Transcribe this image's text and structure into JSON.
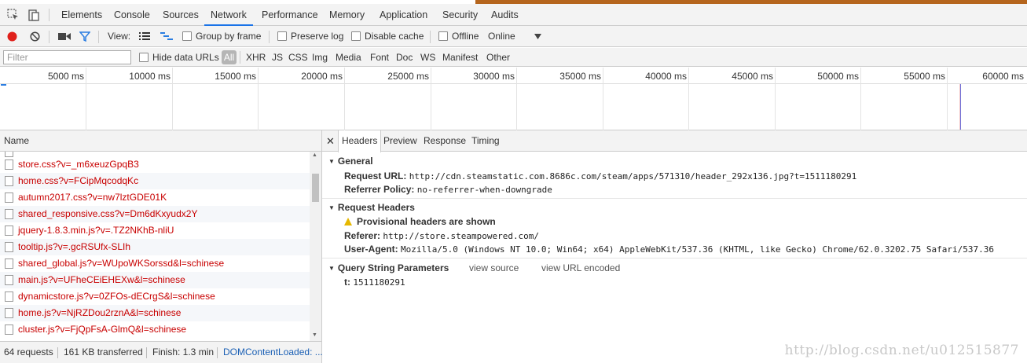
{
  "tabs": [
    "Elements",
    "Console",
    "Sources",
    "Network",
    "Performance",
    "Memory",
    "Application",
    "Security",
    "Audits"
  ],
  "active_tab": "Network",
  "toolbar": {
    "view_label": "View:",
    "group_by_frame": "Group by frame",
    "preserve_log": "Preserve log",
    "disable_cache": "Disable cache",
    "offline": "Offline",
    "throttle": "Online"
  },
  "filterbar": {
    "placeholder": "Filter",
    "hide_data_urls": "Hide data URLs",
    "all": "All",
    "types": [
      "XHR",
      "JS",
      "CSS",
      "Img",
      "Media",
      "Font",
      "Doc",
      "WS",
      "Manifest",
      "Other"
    ]
  },
  "timeline": {
    "ticks": [
      "5000 ms",
      "10000 ms",
      "15000 ms",
      "20000 ms",
      "25000 ms",
      "30000 ms",
      "35000 ms",
      "40000 ms",
      "45000 ms",
      "50000 ms",
      "55000 ms",
      "60000 ms"
    ]
  },
  "requests": {
    "column_name": "Name",
    "items": [
      "store.css?v=_m6xeuzGpqB3",
      "home.css?v=FCipMqcodqKc",
      "autumn2017.css?v=nw7lztGDE01K",
      "shared_responsive.css?v=Dm6dKxyudx2Y",
      "jquery-1.8.3.min.js?v=.TZ2NKhB-nliU",
      "tooltip.js?v=.gcRSUfx-SLIh",
      "shared_global.js?v=WUpoWKSorssd&l=schinese",
      "main.js?v=UFheCEiEHEXw&l=schinese",
      "dynamicstore.js?v=0ZFOs-dECrgS&l=schinese",
      "home.js?v=NjRZDou2rznA&l=schinese",
      "cluster.js?v=FjQpFsA-GlmQ&l=schinese"
    ]
  },
  "status": {
    "requests": "64 requests",
    "transferred": "161 KB transferred",
    "finish": "Finish: 1.3 min",
    "dcl": "DOMContentLoaded: ..."
  },
  "details": {
    "tabs": [
      "Headers",
      "Preview",
      "Response",
      "Timing"
    ],
    "active": "Headers",
    "general": {
      "title": "General",
      "request_url_key": "Request URL:",
      "request_url": "http://cdn.steamstatic.com.8686c.com/steam/apps/571310/header_292x136.jpg?t=1511180291",
      "referrer_policy_key": "Referrer Policy:",
      "referrer_policy": "no-referrer-when-downgrade"
    },
    "request_headers": {
      "title": "Request Headers",
      "warning": "Provisional headers are shown",
      "referer_key": "Referer:",
      "referer": "http://store.steampowered.com/",
      "user_agent_key": "User-Agent:",
      "user_agent": "Mozilla/5.0 (Windows NT 10.0; Win64; x64) AppleWebKit/537.36 (KHTML, like Gecko) Chrome/62.0.3202.75 Safari/537.36"
    },
    "query": {
      "title": "Query String Parameters",
      "view_source": "view source",
      "view_url_encoded": "view URL encoded",
      "t_key": "t:",
      "t_value": "1511180291"
    }
  },
  "watermark": "http://blog.csdn.net/u012515877",
  "colors": {
    "record_red": "#e0201b",
    "accent_blue": "#1a73e8",
    "request_red": "#c80000",
    "filter_blue": "#2a7de1"
  }
}
